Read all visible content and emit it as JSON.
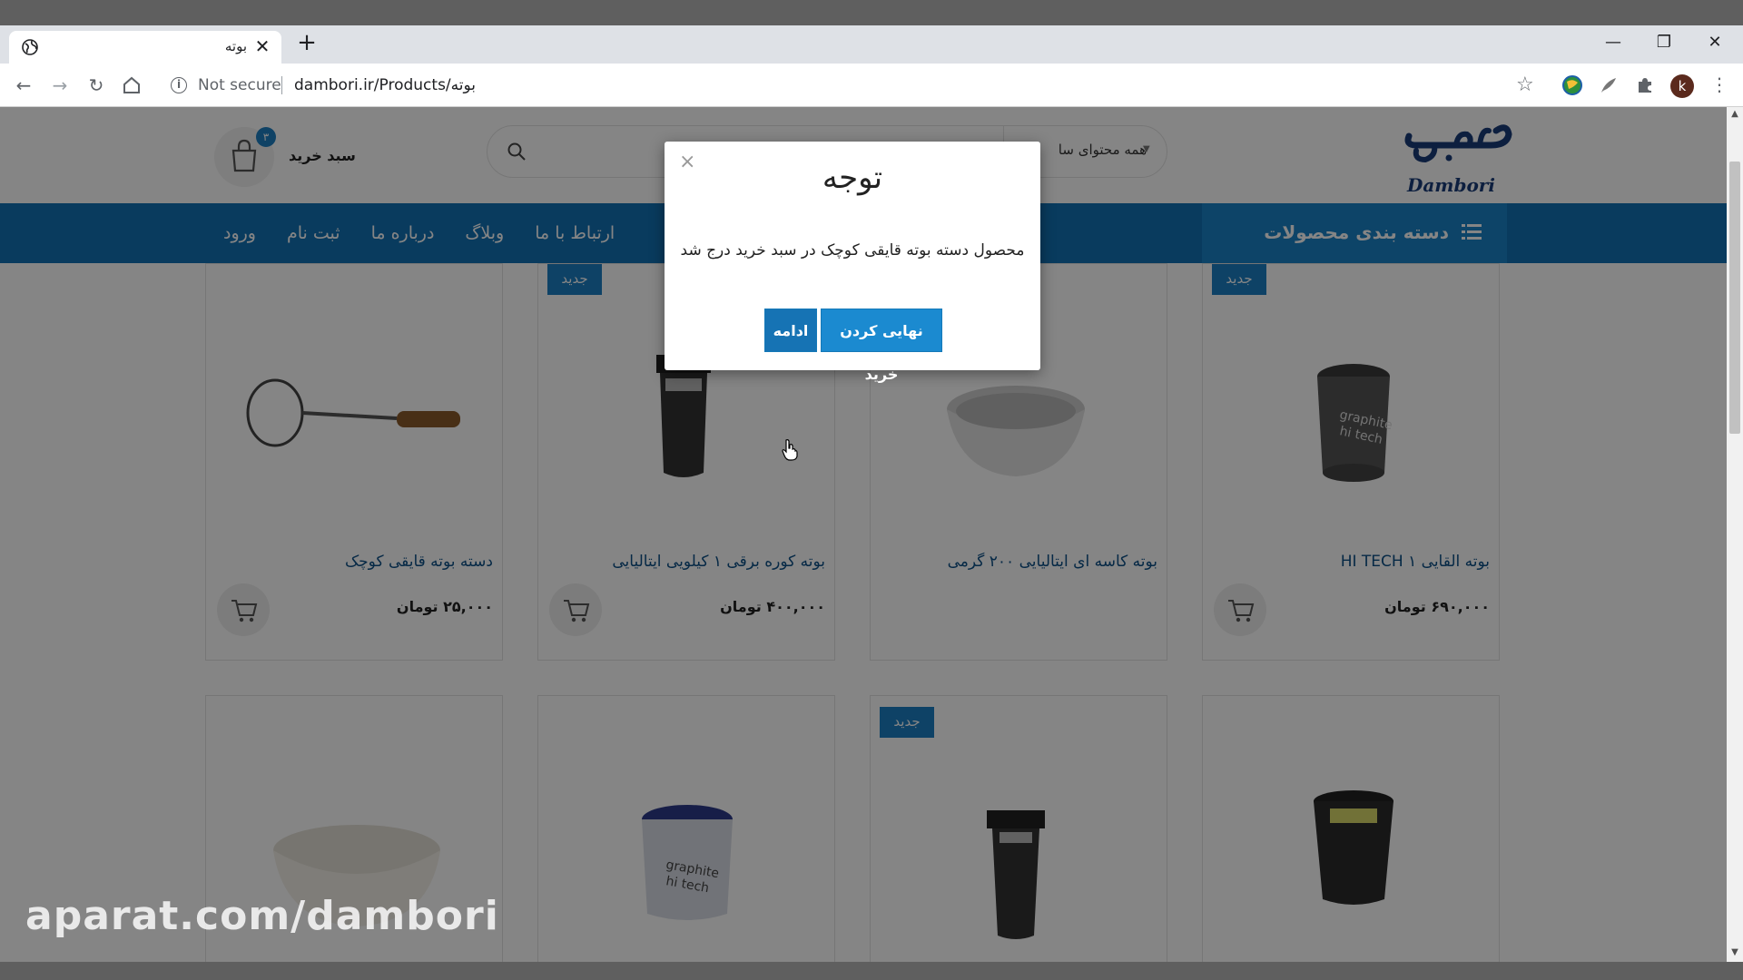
{
  "browser": {
    "tab_title": "بوته",
    "tab_close": "✕",
    "new_tab": "+",
    "window": {
      "minimize": "—",
      "maximize": "❐",
      "close": "✕"
    },
    "security_label": "Not secure",
    "url": "dambori.ir/Products/بوته",
    "profile_initial": "k"
  },
  "header": {
    "logo_text": "Dambori",
    "search": {
      "category": "همه محتوای سا"
    },
    "cart": {
      "label": "سبد خرید",
      "count": "۳"
    }
  },
  "nav": {
    "categories_label": "دسته بندی محصولات",
    "links": [
      "ورود",
      "ثبت نام",
      "درباره ما",
      "وبلاگ",
      "ارتباط با ما"
    ]
  },
  "products": {
    "new_label": "جدید",
    "items": [
      {
        "name": "بوته القایی ۱ HI TECH",
        "price": "۶۹۰,۰۰۰ تومان",
        "is_new": true,
        "image": "graphite-crucible-icon"
      },
      {
        "name": "بوته کاسه ای ایتالیایی ۲۰۰ گرمی",
        "price": "",
        "is_new": false,
        "image": "bowl-crucible-icon"
      },
      {
        "name": "بوته کوره برقی ۱ کیلویی ایتالیایی",
        "price": "۴۰۰,۰۰۰ تومان",
        "is_new": true,
        "image": "furnace-crucible-icon"
      },
      {
        "name": "دسته بوته قایقی کوچک",
        "price": "۲۵,۰۰۰ تومان",
        "is_new": false,
        "image": "crucible-handle-icon"
      },
      {
        "name": "",
        "price": "",
        "is_new": false,
        "image": "black-crucible-icon"
      },
      {
        "name": "",
        "price": "",
        "is_new": true,
        "image": "tall-crucible-icon"
      },
      {
        "name": "",
        "price": "",
        "is_new": false,
        "image": "graphite-crucible-icon"
      },
      {
        "name": "",
        "price": "",
        "is_new": false,
        "image": "white-bowl-icon"
      }
    ]
  },
  "modal": {
    "title": "توجه",
    "message": "محصول دسته بوته قایقی کوچک در سبد خرید درج شد",
    "checkout_label": "نهایی کردن خرید",
    "continue_label": "ادامه",
    "close": "×"
  },
  "watermark": "aparat.com/dambori",
  "colors": {
    "brand_blue": "#1371b5",
    "button_blue": "#1b8ad0",
    "badge_blue": "#1b7fc4",
    "product_name": "#0d4f86"
  }
}
